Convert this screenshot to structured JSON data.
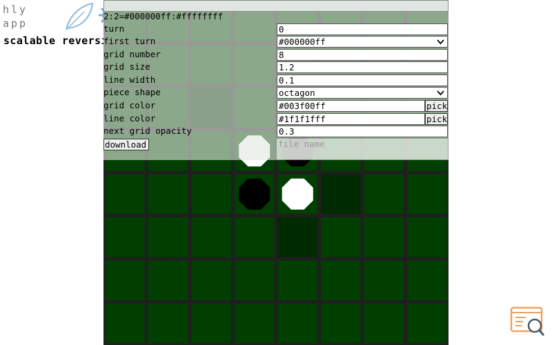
{
  "brand": {
    "logo_line1": "hly",
    "logo_line2": "app",
    "app_title": "scalable reversi"
  },
  "icons": {
    "leaf": "leaf-icon",
    "gear": "gear-icon",
    "corner": "search-console-icon"
  },
  "status": "2:2=#000000ff:#ffffffff",
  "settings": {
    "turn": {
      "label": "turn",
      "value": "0"
    },
    "first_turn": {
      "label": "first turn",
      "value": "#000000ff"
    },
    "grid_number": {
      "label": "grid number",
      "value": "8"
    },
    "grid_size": {
      "label": "grid size",
      "value": "1.2"
    },
    "line_width": {
      "label": "line width",
      "value": "0.1"
    },
    "piece_shape": {
      "label": "piece shape",
      "value": "octagon"
    },
    "grid_color": {
      "label": "grid color",
      "value": "#003f00ff",
      "pick": "pick"
    },
    "line_color": {
      "label": "line color",
      "value": "#1f1f1fff",
      "pick": "pick"
    },
    "next_grid_opacity": {
      "label": "next grid opacity",
      "value": "0.3"
    },
    "download": {
      "label": "download"
    },
    "file_name": {
      "placeholder": "file name"
    }
  },
  "board": {
    "grid_number": 8,
    "grid_color": "#003f00",
    "line_color": "#1f1f1f",
    "next_highlight_color": "#002a00",
    "pieces": [
      {
        "row": 3,
        "col": 3,
        "color": "white"
      },
      {
        "row": 3,
        "col": 4,
        "color": "black"
      },
      {
        "row": 4,
        "col": 3,
        "color": "black"
      },
      {
        "row": 4,
        "col": 4,
        "color": "white"
      }
    ],
    "next_moves": [
      {
        "row": 2,
        "col": 2
      },
      {
        "row": 4,
        "col": 5
      },
      {
        "row": 5,
        "col": 4
      }
    ]
  }
}
